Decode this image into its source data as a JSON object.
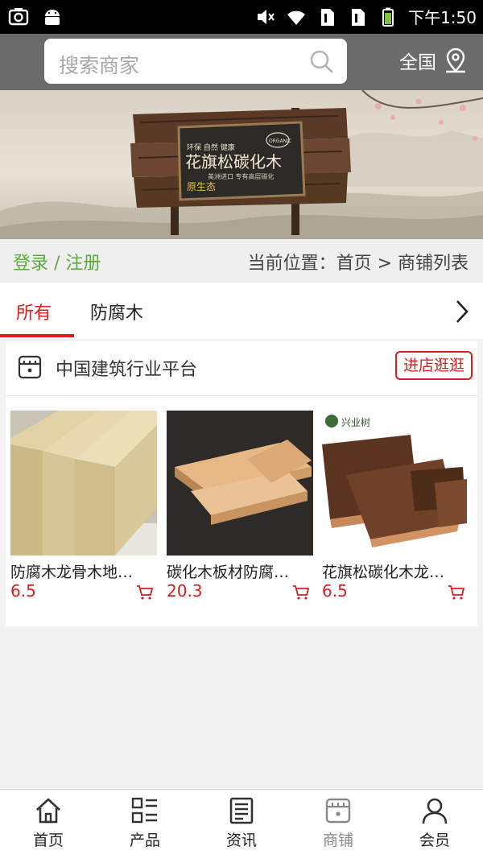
{
  "status_bar": {
    "time": "下午1:50"
  },
  "header": {
    "search_placeholder": "搜索商家",
    "region_label": "全国"
  },
  "banner": {
    "sign_top": "环保  自然  健康",
    "sign_title": "花旗松碳化木",
    "sign_sub": "美洲进口 专有高层碳化",
    "sign_badge": "原生态",
    "organic": "ORGANIC"
  },
  "breadcrumb": {
    "login": "登录 / 注册",
    "location": "当前位置：首页 > 商铺列表"
  },
  "tabs": [
    {
      "label": "所有",
      "active": true
    },
    {
      "label": "防腐木",
      "active": false
    }
  ],
  "shop": {
    "name": "中国建筑行业平台",
    "enter_label": "进店逛逛",
    "products": [
      {
        "name": "防腐木龙骨木地…",
        "price": "6.5"
      },
      {
        "name": "碳化木板材防腐…",
        "price": "20.3"
      },
      {
        "name": "花旗松碳化木龙…",
        "price": "6.5",
        "brand": "兴业树"
      }
    ]
  },
  "bottom_nav": [
    {
      "label": "首页",
      "icon": "home-icon"
    },
    {
      "label": "产品",
      "icon": "grid-list-icon"
    },
    {
      "label": "资讯",
      "icon": "news-icon"
    },
    {
      "label": "商铺",
      "icon": "shop-icon",
      "active": true
    },
    {
      "label": "会员",
      "icon": "user-icon"
    }
  ],
  "colors": {
    "accent": "#d81e1e",
    "green": "#5aac3c",
    "header": "#6b6b6b"
  }
}
